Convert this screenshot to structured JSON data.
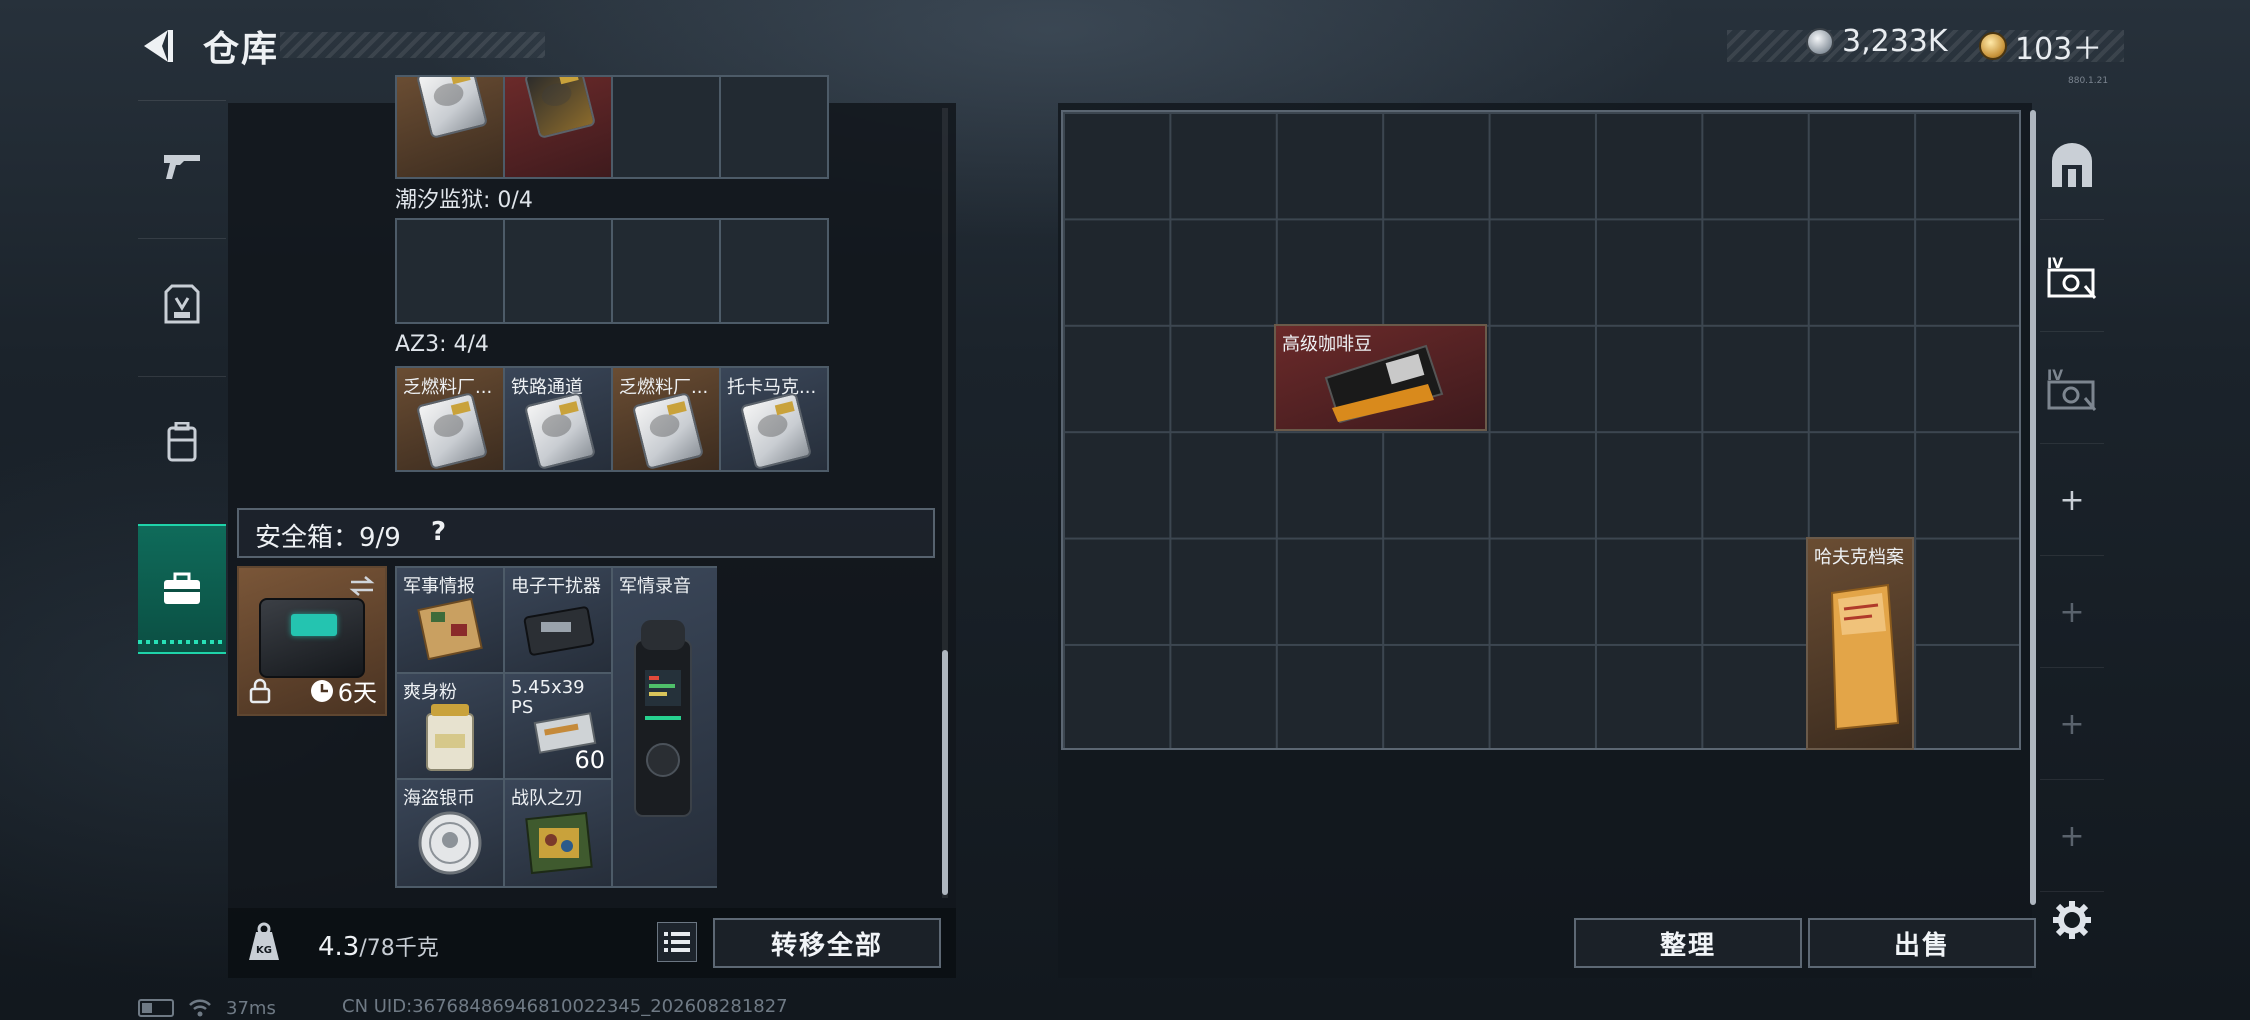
{
  "header": {
    "title": "仓库",
    "currency_silver": "3,233K",
    "currency_gold": "103＋",
    "version": "880.1.21"
  },
  "left_tabs": [
    "gun-icon",
    "armor-icon",
    "backpack-icon",
    "safebox-icon"
  ],
  "key_sections": {
    "top_row": {
      "cells": [
        "",
        "",
        "",
        ""
      ]
    },
    "section1_label": "潮汐监狱: 0/4",
    "section2_label": "AZ3: 4/4",
    "az3_cards": [
      "乏燃料厂...",
      "铁路通道",
      "乏燃料厂...",
      "托卡马克..."
    ]
  },
  "safe_box": {
    "header": "安全箱：9/9",
    "help": "?",
    "timer": "6天",
    "items": [
      {
        "label": "军事情报"
      },
      {
        "label": "电子干扰器"
      },
      {
        "label": "军情录音"
      },
      {
        "label": "爽身粉"
      },
      {
        "label": "5.45x39 PS",
        "count": "60"
      },
      {
        "label": "海盗银币"
      },
      {
        "label": "战队之刃"
      }
    ]
  },
  "bottom": {
    "weight_current": "4.3",
    "weight_max": "/78千克",
    "transfer_all": "转移全部",
    "sort": "整理",
    "sell": "出售"
  },
  "stash": {
    "items": [
      {
        "label": "高级咖啡豆"
      },
      {
        "label": "哈夫克档案"
      }
    ]
  },
  "right_tabs": [
    "room-icon",
    "stash-iv-icon",
    "stash-iv-icon",
    "plus-icon",
    "plus-icon",
    "plus-icon",
    "plus-icon"
  ],
  "status": {
    "ping": "37ms",
    "uid": "CN UID:36768486946810022345_202608281827"
  }
}
